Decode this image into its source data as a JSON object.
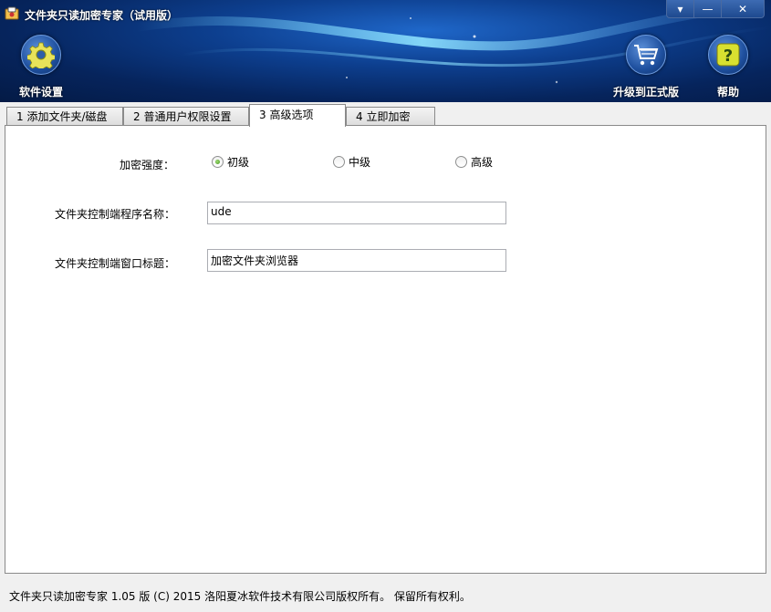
{
  "window": {
    "title": "文件夹只读加密专家（试用版）",
    "controls": {
      "menu": "▾",
      "minimize": "—",
      "close": "✕"
    }
  },
  "toolbar": {
    "settings_label": "软件设置",
    "upgrade_label": "升级到正式版",
    "help_label": "帮助"
  },
  "tabs": [
    {
      "label": "1 添加文件夹/磁盘"
    },
    {
      "label": "2 普通用户权限设置"
    },
    {
      "label": "3 高级选项",
      "active": true
    },
    {
      "label": "4 立即加密"
    }
  ],
  "advanced": {
    "strength_label": "加密强度：",
    "strength_options": [
      "初级",
      "中级",
      "高级"
    ],
    "strength_selected": "初级",
    "program_name_label": "文件夹控制端程序名称：",
    "program_name_value": "ude",
    "window_title_label": "文件夹控制端窗口标题：",
    "window_title_value": "加密文件夹浏览器"
  },
  "status_bar": {
    "text": "文件夹只读加密专家 1.05 版 (C) 2015 洛阳夏冰软件技术有限公司版权所有。 保留所有权利。"
  },
  "colors": {
    "header_dark": "#06245c",
    "header_light": "#1f67c9",
    "radio_checked": "#3e8f13"
  }
}
